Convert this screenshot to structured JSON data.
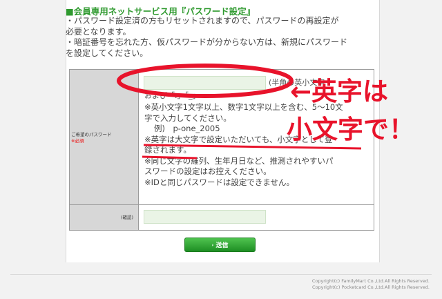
{
  "colors": {
    "accent_green": "#2f9a2f",
    "annotation_red": "#e8132b",
    "input_bg": "#eaf4e6"
  },
  "section": {
    "heading": "■会員専用ネットサービス用『パスワード設定』",
    "intro_lines": [
      "・パスワード設定済の方もリセットされますので、パスワードの再設定が",
      "必要となります。",
      "・暗証番号を忘れた方、仮パスワードが分からない方は、新規にパスワード",
      "を設定してください。"
    ]
  },
  "form": {
    "password_label": "ご希望のパスワード",
    "required_label": "※必須",
    "confirm_label": "(確認)",
    "password_value": "",
    "confirm_value": "",
    "hint_line1": "(半角の英小文字",
    "hint_line2": "および「.」「_」",
    "notes": [
      "※英小文字1文字以上、数字1文字以上を含む、5～10文",
      "字で入力してください。",
      "例)　p-one_2005",
      "※英字は大文字で設定いただいても、小文字として登",
      "録されます。",
      "※同じ文字の羅列、生年月日など、推測されやすいパ",
      "スワードの設定はお控えください。",
      "※IDと同じパスワードは設定できません。"
    ],
    "submit_label": "送信",
    "submit_arrow": "›"
  },
  "footer": {
    "copyright_1": "Copyright(c) FamilyMart Co.,Ltd.All Rights Reserved.",
    "copyright_2": "Copyright(c) Pocketcard Co.,Ltd.All Rights Reserved."
  },
  "annotation": {
    "arrow": "←",
    "line1": "英字は",
    "line2": "小文字で！"
  }
}
